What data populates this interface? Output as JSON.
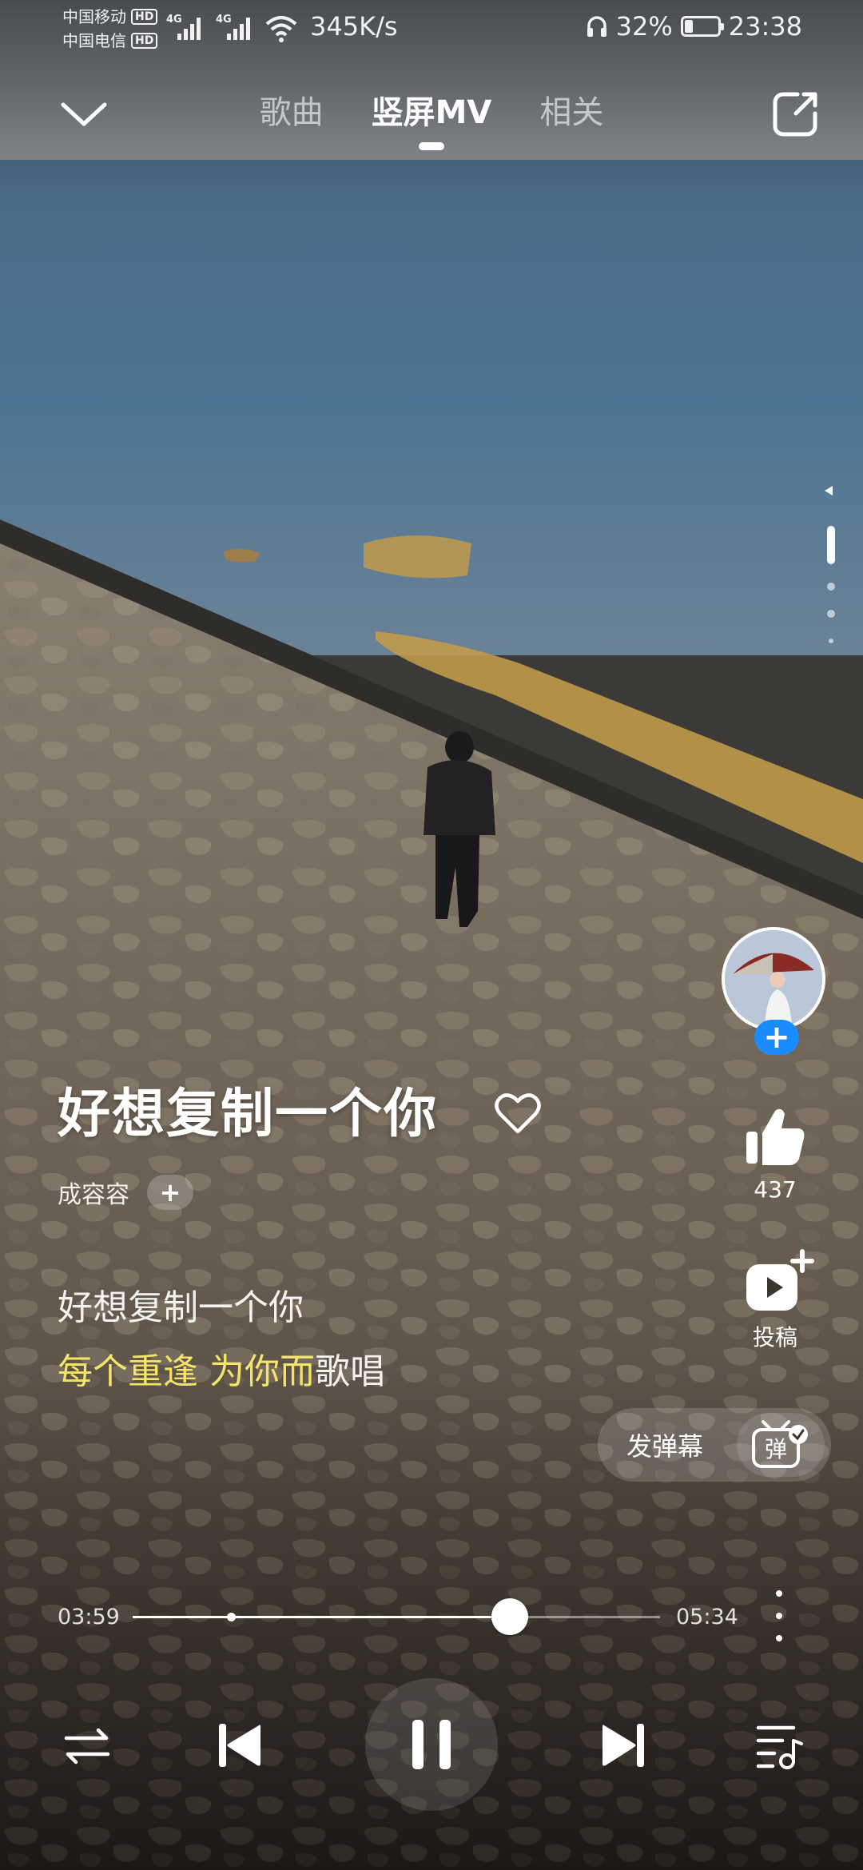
{
  "status_bar": {
    "carrier_1": "中国移动",
    "carrier_2": "中国电信",
    "hd_badge": "HD",
    "network_1": "4G",
    "network_2": "4G",
    "net_speed": "345K/s",
    "battery_percent": "32%",
    "battery_level": 0.32,
    "time": "23:38"
  },
  "nav": {
    "tabs": [
      {
        "label": "歌曲",
        "active": false
      },
      {
        "label": "竖屏MV",
        "active": true
      },
      {
        "label": "相关",
        "active": false
      }
    ]
  },
  "song": {
    "title": "好想复制一个你",
    "artist": "成容容",
    "follow_symbol": "+"
  },
  "lyrics": {
    "line_1": "好想复制一个你",
    "line_2_sung": "每个重逢 为你而",
    "line_2_unsung": "歌唱"
  },
  "actions": {
    "like_count": "437",
    "post_label": "投稿",
    "danmaku_label": "发弹幕",
    "danmaku_icon_text": "弹",
    "follow_symbol": "+"
  },
  "player": {
    "current_time": "03:59",
    "total_time": "05:34",
    "progress": 0.7156,
    "buffer_marker": 0.187
  },
  "colors": {
    "lyric_highlight": "#f5e46a",
    "follow_blue": "#1a8cff"
  },
  "icons": {
    "back": "chevron-down-icon",
    "share": "share-icon",
    "heart": "heart-outline-icon",
    "like": "thumbs-up-icon",
    "post": "video-add-icon",
    "danmaku": "danmaku-tv-icon",
    "shuffle": "repeat-order-icon",
    "prev": "skip-previous-icon",
    "pause": "pause-icon",
    "next": "skip-next-icon",
    "playlist": "playlist-icon",
    "more": "more-vertical-icon"
  }
}
